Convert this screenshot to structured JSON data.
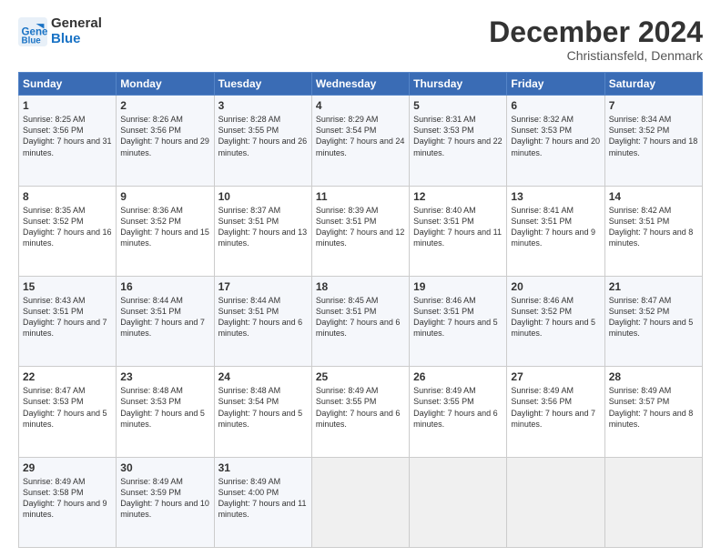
{
  "header": {
    "logo_line1": "General",
    "logo_line2": "Blue",
    "month": "December 2024",
    "location": "Christiansfeld, Denmark"
  },
  "days_of_week": [
    "Sunday",
    "Monday",
    "Tuesday",
    "Wednesday",
    "Thursday",
    "Friday",
    "Saturday"
  ],
  "weeks": [
    [
      {
        "day": "1",
        "sunrise": "Sunrise: 8:25 AM",
        "sunset": "Sunset: 3:56 PM",
        "daylight": "Daylight: 7 hours and 31 minutes."
      },
      {
        "day": "2",
        "sunrise": "Sunrise: 8:26 AM",
        "sunset": "Sunset: 3:56 PM",
        "daylight": "Daylight: 7 hours and 29 minutes."
      },
      {
        "day": "3",
        "sunrise": "Sunrise: 8:28 AM",
        "sunset": "Sunset: 3:55 PM",
        "daylight": "Daylight: 7 hours and 26 minutes."
      },
      {
        "day": "4",
        "sunrise": "Sunrise: 8:29 AM",
        "sunset": "Sunset: 3:54 PM",
        "daylight": "Daylight: 7 hours and 24 minutes."
      },
      {
        "day": "5",
        "sunrise": "Sunrise: 8:31 AM",
        "sunset": "Sunset: 3:53 PM",
        "daylight": "Daylight: 7 hours and 22 minutes."
      },
      {
        "day": "6",
        "sunrise": "Sunrise: 8:32 AM",
        "sunset": "Sunset: 3:53 PM",
        "daylight": "Daylight: 7 hours and 20 minutes."
      },
      {
        "day": "7",
        "sunrise": "Sunrise: 8:34 AM",
        "sunset": "Sunset: 3:52 PM",
        "daylight": "Daylight: 7 hours and 18 minutes."
      }
    ],
    [
      {
        "day": "8",
        "sunrise": "Sunrise: 8:35 AM",
        "sunset": "Sunset: 3:52 PM",
        "daylight": "Daylight: 7 hours and 16 minutes."
      },
      {
        "day": "9",
        "sunrise": "Sunrise: 8:36 AM",
        "sunset": "Sunset: 3:52 PM",
        "daylight": "Daylight: 7 hours and 15 minutes."
      },
      {
        "day": "10",
        "sunrise": "Sunrise: 8:37 AM",
        "sunset": "Sunset: 3:51 PM",
        "daylight": "Daylight: 7 hours and 13 minutes."
      },
      {
        "day": "11",
        "sunrise": "Sunrise: 8:39 AM",
        "sunset": "Sunset: 3:51 PM",
        "daylight": "Daylight: 7 hours and 12 minutes."
      },
      {
        "day": "12",
        "sunrise": "Sunrise: 8:40 AM",
        "sunset": "Sunset: 3:51 PM",
        "daylight": "Daylight: 7 hours and 11 minutes."
      },
      {
        "day": "13",
        "sunrise": "Sunrise: 8:41 AM",
        "sunset": "Sunset: 3:51 PM",
        "daylight": "Daylight: 7 hours and 9 minutes."
      },
      {
        "day": "14",
        "sunrise": "Sunrise: 8:42 AM",
        "sunset": "Sunset: 3:51 PM",
        "daylight": "Daylight: 7 hours and 8 minutes."
      }
    ],
    [
      {
        "day": "15",
        "sunrise": "Sunrise: 8:43 AM",
        "sunset": "Sunset: 3:51 PM",
        "daylight": "Daylight: 7 hours and 7 minutes."
      },
      {
        "day": "16",
        "sunrise": "Sunrise: 8:44 AM",
        "sunset": "Sunset: 3:51 PM",
        "daylight": "Daylight: 7 hours and 7 minutes."
      },
      {
        "day": "17",
        "sunrise": "Sunrise: 8:44 AM",
        "sunset": "Sunset: 3:51 PM",
        "daylight": "Daylight: 7 hours and 6 minutes."
      },
      {
        "day": "18",
        "sunrise": "Sunrise: 8:45 AM",
        "sunset": "Sunset: 3:51 PM",
        "daylight": "Daylight: 7 hours and 6 minutes."
      },
      {
        "day": "19",
        "sunrise": "Sunrise: 8:46 AM",
        "sunset": "Sunset: 3:51 PM",
        "daylight": "Daylight: 7 hours and 5 minutes."
      },
      {
        "day": "20",
        "sunrise": "Sunrise: 8:46 AM",
        "sunset": "Sunset: 3:52 PM",
        "daylight": "Daylight: 7 hours and 5 minutes."
      },
      {
        "day": "21",
        "sunrise": "Sunrise: 8:47 AM",
        "sunset": "Sunset: 3:52 PM",
        "daylight": "Daylight: 7 hours and 5 minutes."
      }
    ],
    [
      {
        "day": "22",
        "sunrise": "Sunrise: 8:47 AM",
        "sunset": "Sunset: 3:53 PM",
        "daylight": "Daylight: 7 hours and 5 minutes."
      },
      {
        "day": "23",
        "sunrise": "Sunrise: 8:48 AM",
        "sunset": "Sunset: 3:53 PM",
        "daylight": "Daylight: 7 hours and 5 minutes."
      },
      {
        "day": "24",
        "sunrise": "Sunrise: 8:48 AM",
        "sunset": "Sunset: 3:54 PM",
        "daylight": "Daylight: 7 hours and 5 minutes."
      },
      {
        "day": "25",
        "sunrise": "Sunrise: 8:49 AM",
        "sunset": "Sunset: 3:55 PM",
        "daylight": "Daylight: 7 hours and 6 minutes."
      },
      {
        "day": "26",
        "sunrise": "Sunrise: 8:49 AM",
        "sunset": "Sunset: 3:55 PM",
        "daylight": "Daylight: 7 hours and 6 minutes."
      },
      {
        "day": "27",
        "sunrise": "Sunrise: 8:49 AM",
        "sunset": "Sunset: 3:56 PM",
        "daylight": "Daylight: 7 hours and 7 minutes."
      },
      {
        "day": "28",
        "sunrise": "Sunrise: 8:49 AM",
        "sunset": "Sunset: 3:57 PM",
        "daylight": "Daylight: 7 hours and 8 minutes."
      }
    ],
    [
      {
        "day": "29",
        "sunrise": "Sunrise: 8:49 AM",
        "sunset": "Sunset: 3:58 PM",
        "daylight": "Daylight: 7 hours and 9 minutes."
      },
      {
        "day": "30",
        "sunrise": "Sunrise: 8:49 AM",
        "sunset": "Sunset: 3:59 PM",
        "daylight": "Daylight: 7 hours and 10 minutes."
      },
      {
        "day": "31",
        "sunrise": "Sunrise: 8:49 AM",
        "sunset": "Sunset: 4:00 PM",
        "daylight": "Daylight: 7 hours and 11 minutes."
      },
      null,
      null,
      null,
      null
    ]
  ]
}
